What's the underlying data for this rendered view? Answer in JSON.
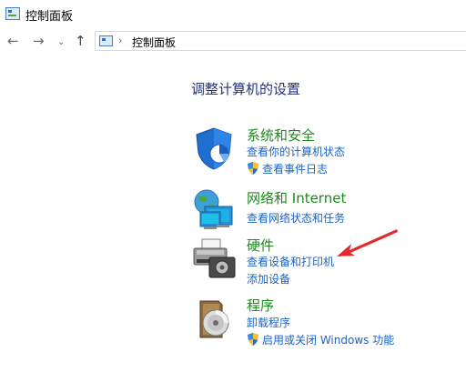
{
  "window": {
    "title": "控制面板"
  },
  "address_bar": {
    "path": "控制面板"
  },
  "main": {
    "heading": "调整计算机的设置",
    "categories": [
      {
        "title": "系统和安全",
        "icon": "system-security-shield-icon",
        "links": [
          "查看你的计算机状态",
          "查看事件日志"
        ]
      },
      {
        "title": "网络和 Internet",
        "icon": "network-globe-icon",
        "links": [
          "查看网络状态和任务"
        ]
      },
      {
        "title": "硬件",
        "icon": "printer-hardware-icon",
        "links": [
          "查看设备和打印机",
          "添加设备"
        ]
      },
      {
        "title": "程序",
        "icon": "programs-disc-icon",
        "links": [
          "卸载程序",
          "启用或关闭 Windows 功能"
        ]
      }
    ]
  },
  "annotation": {
    "color": "#e8292b",
    "icon": "red-arrow-icon"
  }
}
